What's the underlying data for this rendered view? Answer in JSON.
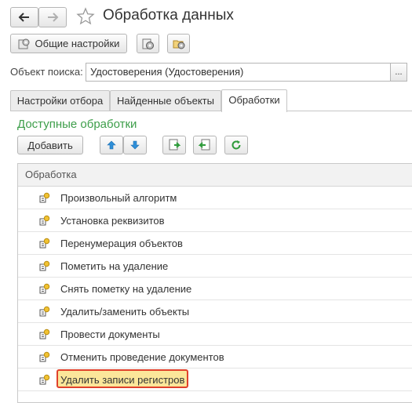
{
  "window": {
    "title": "Обработка данных"
  },
  "toolbar": {
    "general_settings_label": "Общие настройки"
  },
  "search_object": {
    "label": "Объект поиска:",
    "value": "Удостоверения (Удостоверения)",
    "select_label": "..."
  },
  "tabs": [
    {
      "label": "Настройки отбора",
      "active": false
    },
    {
      "label": "Найденные объекты",
      "active": false
    },
    {
      "label": "Обработки",
      "active": true
    }
  ],
  "section": {
    "title": "Доступные обработки",
    "add_label": "Добавить"
  },
  "table": {
    "header": "Обработка",
    "rows": [
      {
        "label": "Произвольный алгоритм"
      },
      {
        "label": "Установка реквизитов"
      },
      {
        "label": "Перенумерация объектов"
      },
      {
        "label": "Пометить на удаление"
      },
      {
        "label": "Снять пометку на удаление"
      },
      {
        "label": "Удалить/заменить объекты"
      },
      {
        "label": "Провести документы"
      },
      {
        "label": "Отменить проведение документов"
      },
      {
        "label": "Удалить записи регистров",
        "selected": true
      }
    ]
  },
  "colors": {
    "accent_green": "#3d9e4a",
    "highlight_fill": "#fbe69a",
    "highlight_border": "#e0412c"
  }
}
